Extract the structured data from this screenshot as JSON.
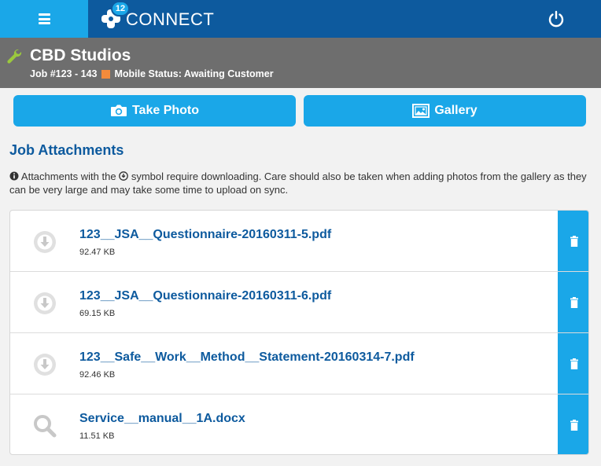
{
  "app": {
    "name": "CONNECT",
    "notification_count": "12",
    "menu_icon": "hamburger-icon",
    "power_icon": "power-icon"
  },
  "header": {
    "company": "CBD Studios",
    "job": "Job #123 - 143",
    "mobile_status": "Mobile Status: Awaiting Customer",
    "status_color": "#f38b3c"
  },
  "actions": {
    "take_photo": "Take Photo",
    "gallery": "Gallery"
  },
  "attachments": {
    "title": "Job Attachments",
    "info_before": "Attachments with the",
    "info_after": "symbol require downloading. Care should also be taken when adding photos from the gallery as they can be very large and may take some time to upload on sync.",
    "items": [
      {
        "name": "123__JSA__Questionnaire-20160311-5.pdf",
        "size": "92.47 KB",
        "icon": "download-icon"
      },
      {
        "name": "123__JSA__Questionnaire-20160311-6.pdf",
        "size": "69.15 KB",
        "icon": "download-icon"
      },
      {
        "name": "123__Safe__Work__Method__Statement-20160314-7.pdf",
        "size": "92.46 KB",
        "icon": "download-icon"
      },
      {
        "name": "Service__manual__1A.docx",
        "size": "11.51 KB",
        "icon": "search-icon"
      }
    ]
  },
  "colors": {
    "topbar": "#0d5a9e",
    "accent": "#1aa7e8",
    "header": "#6e6e6e",
    "link": "#0d5a9e"
  }
}
